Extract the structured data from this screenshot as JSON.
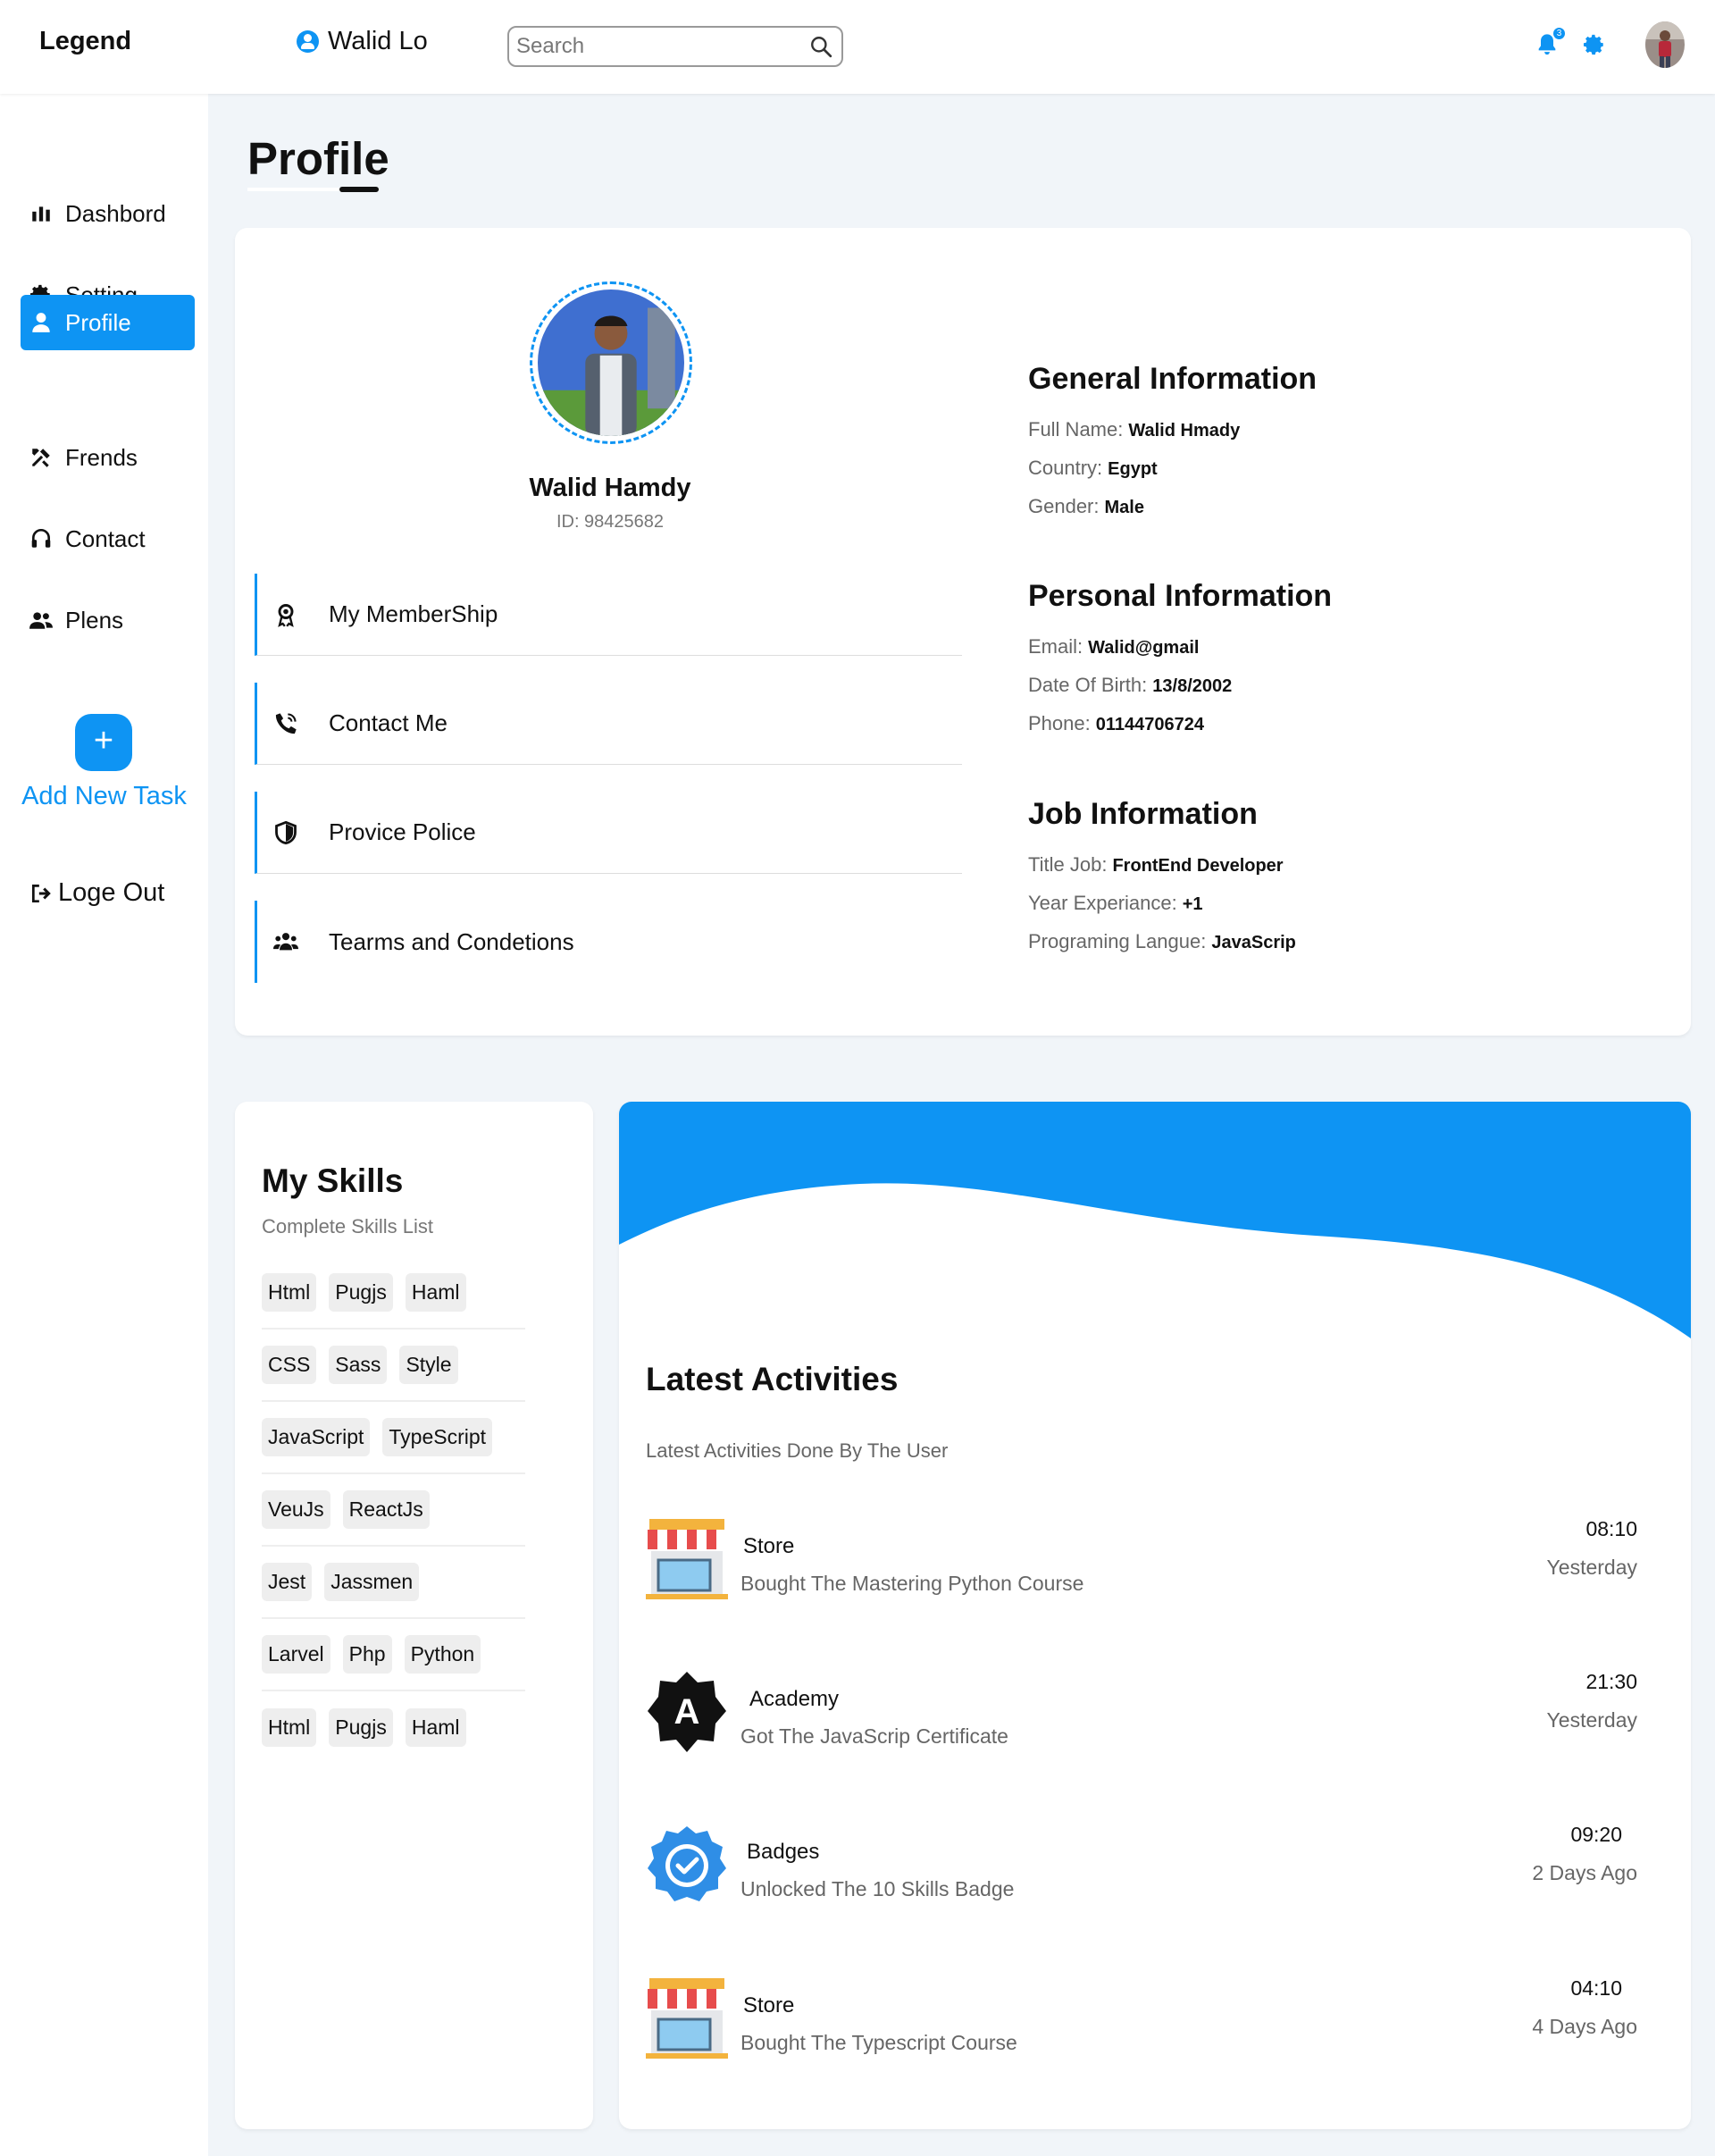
{
  "header": {
    "logo": "Legend",
    "user_name": "Walid Lo",
    "search_placeholder": "Search",
    "notification_count": "3"
  },
  "sidebar": {
    "items": [
      {
        "label": "Dashbord",
        "icon": "bar-chart-icon"
      },
      {
        "label": "Setting",
        "icon": "gear-icon"
      },
      {
        "label": "Profile",
        "icon": "user-icon",
        "active": true
      },
      {
        "label": "Frends",
        "icon": "tools-icon"
      },
      {
        "label": "Contact",
        "icon": "headset-icon"
      },
      {
        "label": "Plens",
        "icon": "users-icon"
      }
    ],
    "add_task_button": "+",
    "add_task_label": "Add New Task",
    "logout_label": "Loge Out"
  },
  "page_title": "Profile",
  "profile": {
    "name": "Walid Hamdy",
    "id": "ID: 98425682",
    "menu": [
      {
        "label": "My MemberShip",
        "icon": "award-icon"
      },
      {
        "label": "Contact Me",
        "icon": "phone-icon"
      },
      {
        "label": "Provice Police",
        "icon": "shield-icon"
      },
      {
        "label": "Tearms and Condetions",
        "icon": "users-icon"
      }
    ]
  },
  "info": {
    "general": {
      "title": "General Information",
      "rows": [
        {
          "label": "Full Name:",
          "value": "Walid Hmady"
        },
        {
          "label": "Country:",
          "value": "Egypt"
        },
        {
          "label": "Gender:",
          "value": "Male"
        }
      ]
    },
    "personal": {
      "title": "Personal Information",
      "rows": [
        {
          "label": "Email:",
          "value": "Walid@gmail"
        },
        {
          "label": "Date Of Birth:",
          "value": "13/8/2002"
        },
        {
          "label": "Phone:",
          "value": "01144706724"
        }
      ]
    },
    "job": {
      "title": "Job Information",
      "rows": [
        {
          "label": "Title Job:",
          "value": "FrontEnd Developer"
        },
        {
          "label": "Year Experiance:",
          "value": "+1"
        },
        {
          "label": "Programing Langue:",
          "value": "JavaScrip"
        }
      ]
    }
  },
  "skills": {
    "title": "My Skills",
    "subtitle": "Complete Skills List",
    "rows": [
      [
        "Html",
        "Pugjs",
        "Haml"
      ],
      [
        "CSS",
        "Sass",
        "Style"
      ],
      [
        "JavaScript",
        "TypeScript"
      ],
      [
        "VeuJs",
        "ReactJs"
      ],
      [
        "Jest",
        "Jassmen"
      ],
      [
        "Larvel",
        "Php",
        "Python"
      ],
      [
        "Html",
        "Pugjs",
        "Haml"
      ]
    ]
  },
  "activities": {
    "title": "Latest Activities",
    "subtitle": "Latest Activities Done By The User",
    "items": [
      {
        "icon": "store-icon",
        "name": "Store",
        "desc": "Bought The Mastering Python Course",
        "time": "08:10",
        "day": "Yesterday"
      },
      {
        "icon": "academy-icon",
        "name": "Academy",
        "desc": "Got The JavaScrip Certificate",
        "time": "21:30",
        "day": "Yesterday"
      },
      {
        "icon": "badge-icon",
        "name": "Badges",
        "desc": "Unlocked The 10 Skills Badge",
        "time": "09:20",
        "day": "2 Days Ago"
      },
      {
        "icon": "store-icon",
        "name": "Store",
        "desc": "Bought The Typescript Course",
        "time": "04:10",
        "day": "4 Days Ago"
      }
    ]
  },
  "colors": {
    "accent": "#0e94f3",
    "background": "#f1f5f9"
  }
}
